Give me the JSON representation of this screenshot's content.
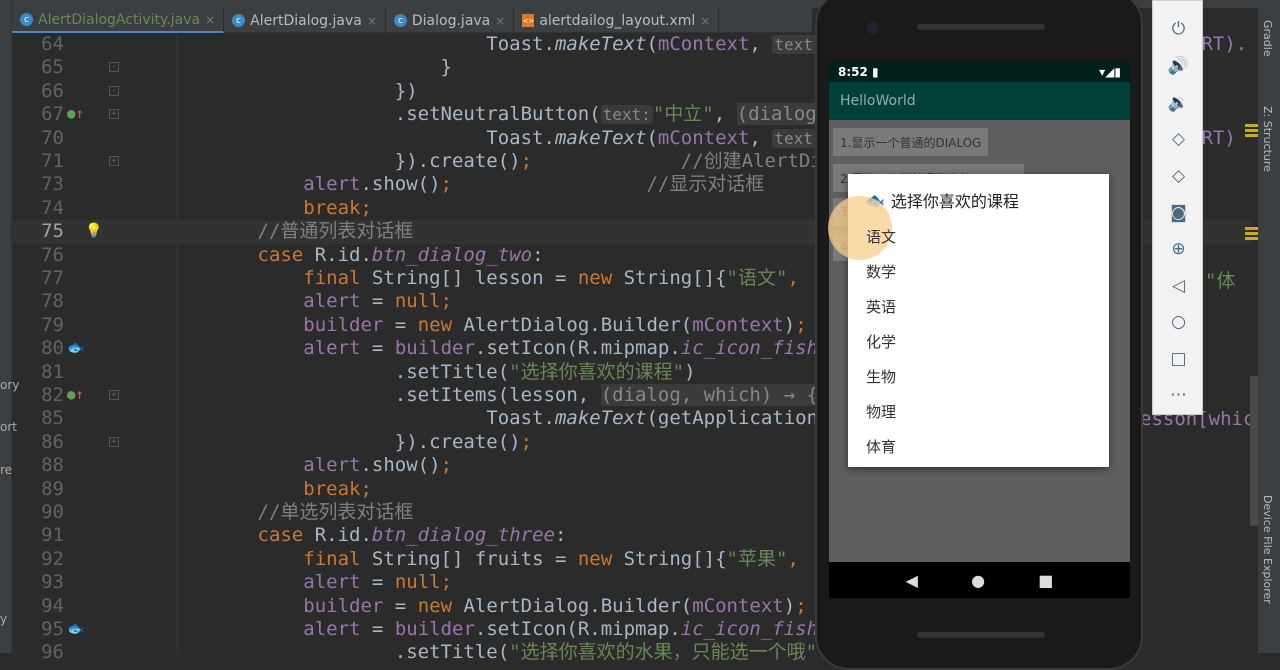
{
  "tabs": [
    {
      "label": "AlertDialogActivity.java",
      "icon": "c"
    },
    {
      "label": "AlertDialog.java",
      "icon": "c"
    },
    {
      "label": "Dialog.java",
      "icon": "c"
    },
    {
      "label": "alertdailog_layout.xml",
      "icon": "xml"
    }
  ],
  "left_panel_labels": [
    "ory",
    "ort",
    "re",
    "y"
  ],
  "code_lines": [
    {
      "n": "64",
      "indent": 28,
      "tokens": [
        [
          "",
          "Toast."
        ],
        [
          "i",
          "makeText"
        ],
        [
          "",
          "("
        ],
        [
          "m",
          "mContext"
        ],
        [
          "",
          ", "
        ],
        [
          "hint",
          "text:"
        ]
      ]
    },
    {
      "n": "65",
      "indent": 24,
      "fold": "-",
      "tokens": [
        [
          "",
          "}"
        ]
      ]
    },
    {
      "n": "66",
      "indent": 20,
      "fold": "-",
      "tokens": [
        [
          "",
          "})"
        ]
      ]
    },
    {
      "n": "67",
      "indent": 20,
      "mark": "impl",
      "fold": "+",
      "tokens": [
        [
          "",
          ".setNeutralButton("
        ],
        [
          "hint",
          "text:"
        ],
        [
          "s",
          "\"中立\""
        ],
        [
          "",
          ", "
        ],
        [
          "lam",
          "(dialog"
        ]
      ]
    },
    {
      "n": "70",
      "indent": 28,
      "tokens": [
        [
          "",
          "Toast."
        ],
        [
          "i",
          "makeText"
        ],
        [
          "",
          "("
        ],
        [
          "m",
          "mContext"
        ],
        [
          "",
          ", "
        ],
        [
          "hint",
          "text:"
        ]
      ]
    },
    {
      "n": "71",
      "indent": 20,
      "fold": "+",
      "tokens": [
        [
          "",
          "}).create()"
        ],
        [
          "k",
          ";"
        ],
        [
          "",
          "             "
        ],
        [
          "c",
          "//创建AlertDi"
        ]
      ]
    },
    {
      "n": "73",
      "indent": 12,
      "tokens": [
        [
          "m",
          "alert"
        ],
        [
          "",
          ".show()"
        ],
        [
          "k",
          ";"
        ],
        [
          "",
          "                 "
        ],
        [
          "c",
          "//显示对话框"
        ]
      ]
    },
    {
      "n": "74",
      "indent": 12,
      "tokens": [
        [
          "k",
          "break;"
        ]
      ]
    },
    {
      "n": "75",
      "indent": 8,
      "current": true,
      "mark": "bulb",
      "tokens": [
        [
          "c",
          "//普通列表对话框"
        ]
      ]
    },
    {
      "n": "76",
      "indent": 8,
      "tokens": [
        [
          "k",
          "case "
        ],
        [
          "",
          "R.id."
        ],
        [
          "mi",
          "btn_dialog_two"
        ],
        [
          "",
          ":"
        ]
      ]
    },
    {
      "n": "77",
      "indent": 12,
      "tokens": [
        [
          "k",
          "final "
        ],
        [
          "",
          "String[] lesson = "
        ],
        [
          "k",
          "new "
        ],
        [
          "",
          "String[]{"
        ],
        [
          "s",
          "\"语文\""
        ],
        [
          "k",
          ", "
        ],
        [
          "s",
          "'"
        ]
      ]
    },
    {
      "n": "78",
      "indent": 12,
      "tokens": [
        [
          "m",
          "alert"
        ],
        [
          "k",
          ""
        ],
        [
          "",
          " = "
        ],
        [
          "k",
          "null;"
        ]
      ]
    },
    {
      "n": "79",
      "indent": 12,
      "tokens": [
        [
          "m",
          "builder"
        ],
        [
          "",
          " = "
        ],
        [
          "k",
          "new "
        ],
        [
          "",
          "AlertDialog.Builder("
        ],
        [
          "m",
          "mContext"
        ],
        [
          "",
          ")"
        ],
        [
          "k",
          ";"
        ]
      ]
    },
    {
      "n": "80",
      "indent": 12,
      "mark": "fish",
      "tokens": [
        [
          "m",
          "alert"
        ],
        [
          "",
          " = "
        ],
        [
          "m",
          "builder"
        ],
        [
          "",
          ".setIcon(R.mipmap."
        ],
        [
          "mi",
          "ic_icon_fish"
        ]
      ]
    },
    {
      "n": "81",
      "indent": 20,
      "tokens": [
        [
          "",
          ".setTitle("
        ],
        [
          "s",
          "\"选择你喜欢的课程\""
        ],
        [
          "",
          ")"
        ]
      ]
    },
    {
      "n": "82",
      "indent": 20,
      "mark": "impl",
      "fold": "+",
      "tokens": [
        [
          "",
          ".setItems(lesson, "
        ],
        [
          "lam",
          "(dialog, which) → {"
        ]
      ]
    },
    {
      "n": "85",
      "indent": 28,
      "tokens": [
        [
          "",
          "Toast."
        ],
        [
          "i",
          "makeText"
        ],
        [
          "",
          "(getApplication"
        ]
      ]
    },
    {
      "n": "86",
      "indent": 20,
      "fold": "+",
      "tokens": [
        [
          "",
          "}).create()"
        ],
        [
          "k",
          ";"
        ]
      ]
    },
    {
      "n": "88",
      "indent": 12,
      "tokens": [
        [
          "m",
          "alert"
        ],
        [
          "",
          ".show()"
        ],
        [
          "k",
          ";"
        ]
      ]
    },
    {
      "n": "89",
      "indent": 12,
      "tokens": [
        [
          "k",
          "break;"
        ]
      ]
    },
    {
      "n": "90",
      "indent": 8,
      "tokens": [
        [
          "c",
          "//单选列表对话框"
        ]
      ]
    },
    {
      "n": "91",
      "indent": 8,
      "tokens": [
        [
          "k",
          "case "
        ],
        [
          "",
          "R.id."
        ],
        [
          "mi",
          "btn_dialog_three"
        ],
        [
          "",
          ":"
        ]
      ]
    },
    {
      "n": "92",
      "indent": 12,
      "tokens": [
        [
          "k",
          "final "
        ],
        [
          "",
          "String[] fruits = "
        ],
        [
          "k",
          "new "
        ],
        [
          "",
          "String[]{"
        ],
        [
          "s",
          "\"苹果\""
        ],
        [
          "k",
          ", "
        ],
        [
          "s",
          "'"
        ]
      ]
    },
    {
      "n": "93",
      "indent": 12,
      "tokens": [
        [
          "m",
          "alert"
        ],
        [
          "",
          " = "
        ],
        [
          "k",
          "null;"
        ]
      ]
    },
    {
      "n": "94",
      "indent": 12,
      "tokens": [
        [
          "m",
          "builder"
        ],
        [
          "",
          " = "
        ],
        [
          "k",
          "new "
        ],
        [
          "",
          "AlertDialog.Builder("
        ],
        [
          "m",
          "mContext"
        ],
        [
          "",
          ")"
        ],
        [
          "k",
          ";"
        ]
      ]
    },
    {
      "n": "95",
      "indent": 12,
      "mark": "fish",
      "tokens": [
        [
          "m",
          "alert"
        ],
        [
          "",
          " = "
        ],
        [
          "m",
          "builder"
        ],
        [
          "",
          ".setIcon(R.mipmap."
        ],
        [
          "mi",
          "ic_icon_fish"
        ]
      ]
    },
    {
      "n": "96",
      "indent": 20,
      "tokens": [
        [
          "",
          ".setTitle("
        ],
        [
          "s",
          "\"选择你喜欢的水果，只能选一个哦\""
        ]
      ]
    }
  ],
  "overflow_fragments": {
    "ort1": "ORT).",
    "ort2": "ORT)",
    "ti": "\"体",
    "which": "esson[which"
  },
  "right_tool_windows": [
    "Gradle",
    "Z: Structure",
    "Device File Explorer"
  ],
  "phone": {
    "time": "8:52",
    "app_title": "HelloWorld",
    "buttons": [
      "1.显示一个普通的DIALOG",
      "2.显示一个带普通列表的DIALOG",
      "3",
      "4"
    ],
    "dialog": {
      "title": "选择你喜欢的课程",
      "items": [
        "语文",
        "数学",
        "英语",
        "化学",
        "生物",
        "物理",
        "体育"
      ]
    }
  },
  "emulator_toolbar": [
    "power",
    "volume-up",
    "volume-down",
    "rotate-left",
    "rotate-right",
    "screenshot",
    "zoom",
    "back",
    "home",
    "overview",
    "more"
  ]
}
